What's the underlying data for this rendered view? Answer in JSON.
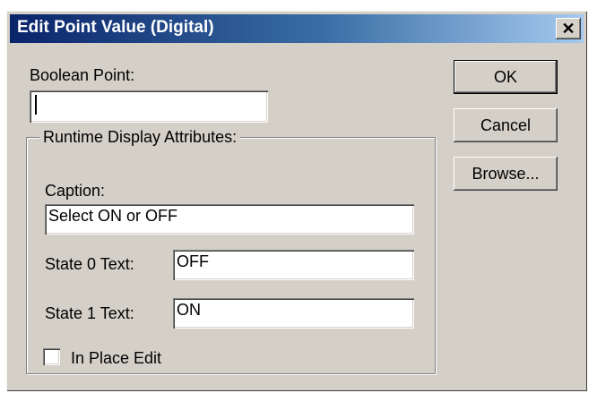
{
  "dialog": {
    "title": "Edit Point Value (Digital)",
    "close_glyph": "✕"
  },
  "boolean_point": {
    "label": "Boolean Point:",
    "value": ""
  },
  "group": {
    "legend": "Runtime Display Attributes:",
    "caption_label": "Caption:",
    "caption_value": "Select ON or OFF",
    "state0_label": "State 0 Text:",
    "state0_value": "OFF",
    "state1_label": "State 1 Text:",
    "state1_value": "ON",
    "in_place_edit_label": "In Place Edit",
    "in_place_edit_checked": false
  },
  "buttons": {
    "ok": "OK",
    "cancel": "Cancel",
    "browse": "Browse..."
  },
  "colors": {
    "title_bar_start": "#0a246a",
    "title_bar_end": "#a6caf0",
    "face": "#d4d0c8"
  }
}
